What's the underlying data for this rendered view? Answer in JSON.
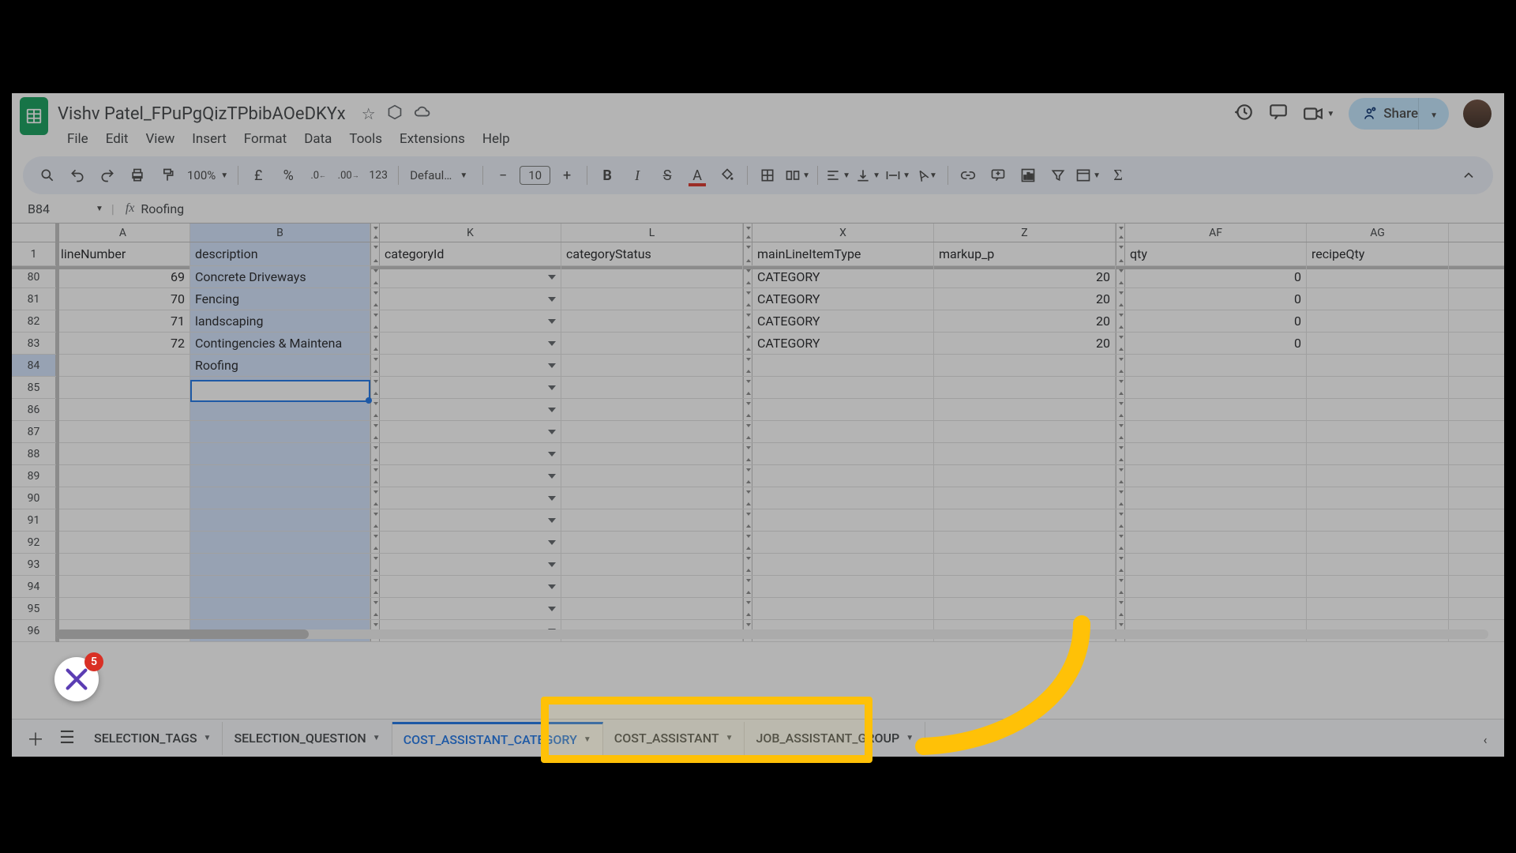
{
  "doc": {
    "title": "Vishv Patel_FPuPgQizTPbibAOeDKYx",
    "share_label": "Share"
  },
  "menus": [
    "File",
    "Edit",
    "View",
    "Insert",
    "Format",
    "Data",
    "Tools",
    "Extensions",
    "Help"
  ],
  "toolbar": {
    "zoom": "100%",
    "currency": "£",
    "percent": "%",
    "dec_dec": ".0",
    "inc_dec": ".00",
    "num123": "123",
    "font": "Defaul…",
    "size": "10"
  },
  "namebox": {
    "ref": "B84",
    "formula": "Roofing"
  },
  "columns": {
    "A": "A",
    "B": "B",
    "K": "K",
    "L": "L",
    "X": "X",
    "Z": "Z",
    "AF": "AF",
    "AG": "AG"
  },
  "headers": {
    "A": "lineNumber",
    "B": "description",
    "K": "categoryId",
    "L": "categoryStatus",
    "X": "mainLineItemType",
    "Z": "markup_p",
    "AF": "qty",
    "AG": "recipeQty"
  },
  "rows": [
    {
      "rn": "80",
      "A": "69",
      "B": "Concrete Driveways",
      "X": "CATEGORY",
      "Z": "20",
      "AF": "0"
    },
    {
      "rn": "81",
      "A": "70",
      "B": "Fencing",
      "X": "CATEGORY",
      "Z": "20",
      "AF": "0"
    },
    {
      "rn": "82",
      "A": "71",
      "B": "landscaping",
      "X": "CATEGORY",
      "Z": "20",
      "AF": "0"
    },
    {
      "rn": "83",
      "A": "72",
      "B": "Contingencies & Maintena",
      "X": "CATEGORY",
      "Z": "20",
      "AF": "0"
    },
    {
      "rn": "84",
      "A": "",
      "B": "Roofing",
      "X": "",
      "Z": "",
      "AF": ""
    },
    {
      "rn": "85"
    },
    {
      "rn": "86"
    },
    {
      "rn": "87"
    },
    {
      "rn": "88"
    },
    {
      "rn": "89"
    },
    {
      "rn": "90"
    },
    {
      "rn": "91"
    },
    {
      "rn": "92"
    },
    {
      "rn": "93"
    },
    {
      "rn": "94"
    },
    {
      "rn": "95"
    },
    {
      "rn": "96"
    }
  ],
  "tabs": {
    "list": [
      {
        "label": "SELECTION_TAGS",
        "active": false
      },
      {
        "label": "SELECTION_QUESTION",
        "active": false
      },
      {
        "label": "COST_ASSISTANT_CATEGORY",
        "active": true
      },
      {
        "label": "COST_ASSISTANT",
        "active": false
      },
      {
        "label": "JOB_ASSISTANT_GROUP",
        "active": false
      }
    ]
  },
  "badge": {
    "count": "5"
  }
}
